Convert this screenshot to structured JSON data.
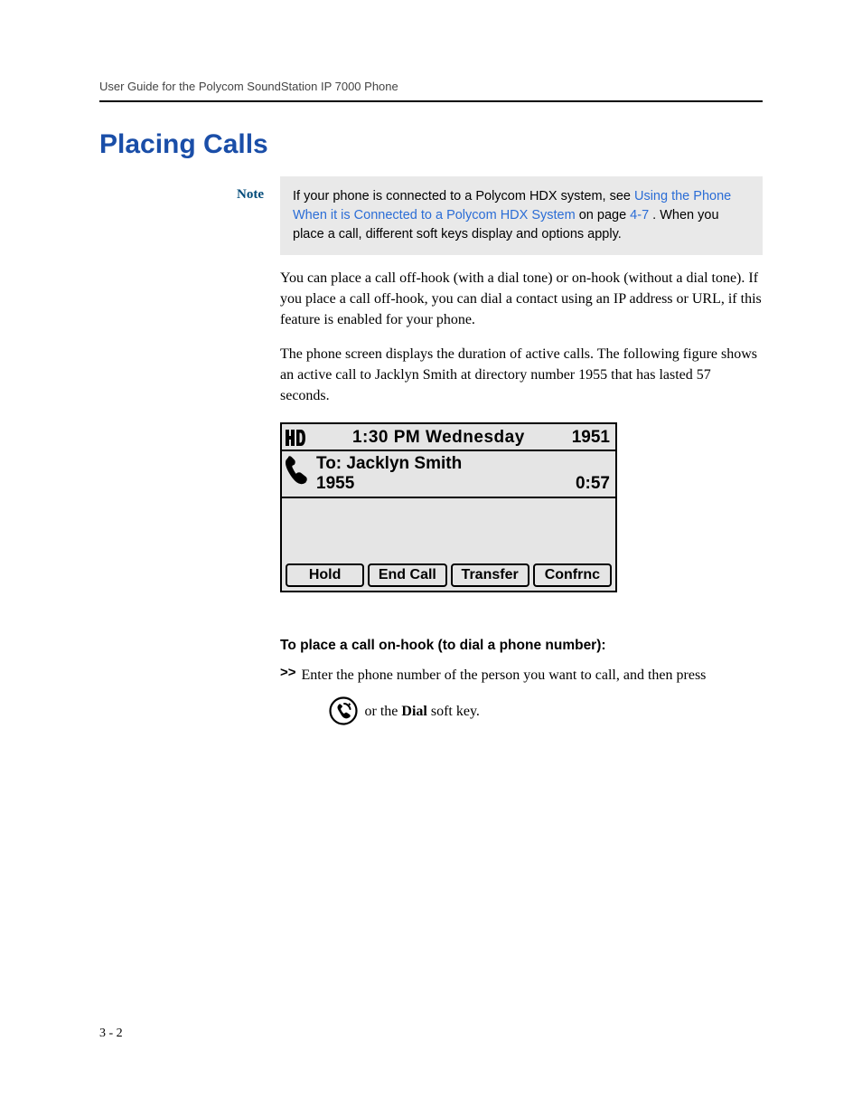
{
  "header": {
    "title": "User Guide for the Polycom SoundStation IP 7000 Phone"
  },
  "heading": "Placing Calls",
  "note": {
    "label": "Note",
    "prefix": "If your phone is connected to a Polycom HDX system, see ",
    "link_text": "Using the Phone When it is Connected to a Polycom HDX System",
    "mid": " on page ",
    "page_ref": "4-7",
    "suffix": ". When you place a call, different soft keys display and options apply."
  },
  "body": {
    "p1": "You can place a call off-hook (with a dial tone) or on-hook (without a dial tone). If you place a call off-hook, you can dial a contact using an IP address or URL, if this feature is enabled for your phone.",
    "p2": "The phone screen displays the duration of active calls. The following figure shows an active call to Jacklyn Smith at directory number 1955 that has lasted 57 seconds."
  },
  "lcd": {
    "hd_label": "HD",
    "time": "1:30  PM Wednesday",
    "ext_top": "1951",
    "to_label": "To: Jacklyn Smith",
    "ext": "1955",
    "duration": "0:57",
    "softkeys": [
      "Hold",
      "End Call",
      "Transfer",
      "Confrnc"
    ]
  },
  "subheading": "To place a call on-hook (to dial a phone number):",
  "step": {
    "marker": ">>",
    "line1": "Enter the phone number of the person you want to call, and then press",
    "line2_prefix": "",
    "line2_mid": " or the ",
    "line2_bold": "Dial",
    "line2_suffix": " soft key."
  },
  "page_number": "3 - 2"
}
